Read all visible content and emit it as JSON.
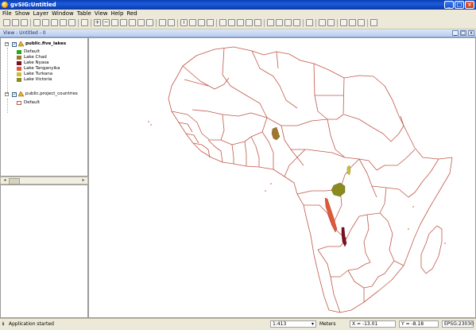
{
  "window": {
    "title": "gvSIG:Untitled"
  },
  "menu": [
    "File",
    "Show",
    "Layer",
    "Window",
    "Table",
    "View",
    "Help",
    "Red"
  ],
  "view": {
    "title": "View : Untitled - 0"
  },
  "toc": {
    "layers": [
      {
        "name": "public.five_lakes",
        "visible": true,
        "legend": [
          {
            "label": "Default",
            "color": "#22aa22"
          },
          {
            "label": "Lake Chad",
            "color": "#a0762c"
          },
          {
            "label": "Lake Nyasa",
            "color": "#7a1020"
          },
          {
            "label": "Lake Tanganyika",
            "color": "#e05a3a"
          },
          {
            "label": "Lake Turkana",
            "color": "#c8c03a"
          },
          {
            "label": "Lake Victoria",
            "color": "#8a8a20"
          }
        ]
      },
      {
        "name": "public.project_countries",
        "visible": true,
        "legend": [
          {
            "label": "Default",
            "color": "#ffffff"
          }
        ]
      }
    ]
  },
  "status": {
    "message": "Application started",
    "scale": "1:413",
    "units": "Meters",
    "x": "X = -13.01",
    "y": "Y = -8.18",
    "crs": "EPSG:23030"
  },
  "colors": {
    "country_border": "#c0584a",
    "titlebar": "#1d5ae0"
  }
}
